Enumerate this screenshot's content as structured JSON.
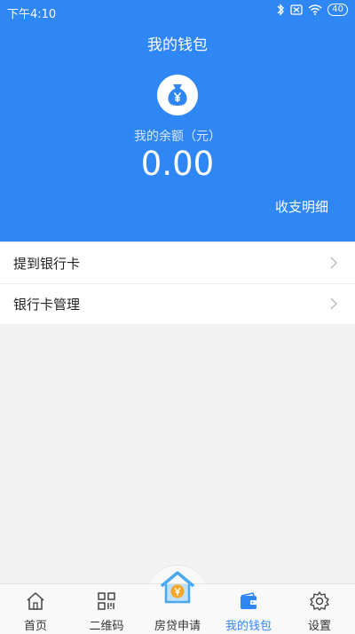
{
  "status": {
    "time": "下午4:10",
    "battery": "40"
  },
  "header": {
    "title": "我的钱包",
    "balance_label": "我的余额（元）",
    "balance": "0.00",
    "detail_link": "收支明细"
  },
  "menu": [
    {
      "label": "提到银行卡"
    },
    {
      "label": "银行卡管理"
    }
  ],
  "tabs": [
    {
      "label": "首页",
      "icon": "home-icon"
    },
    {
      "label": "二维码",
      "icon": "qrcode-icon"
    },
    {
      "label": "房贷申请",
      "icon": "house-loan-icon"
    },
    {
      "label": "我的钱包",
      "icon": "wallet-icon",
      "active": true
    },
    {
      "label": "设置",
      "icon": "gear-icon"
    }
  ],
  "colors": {
    "brand": "#2f86f5",
    "page_bg": "#f2f2f2",
    "tab_bg": "#f9f9f9"
  }
}
